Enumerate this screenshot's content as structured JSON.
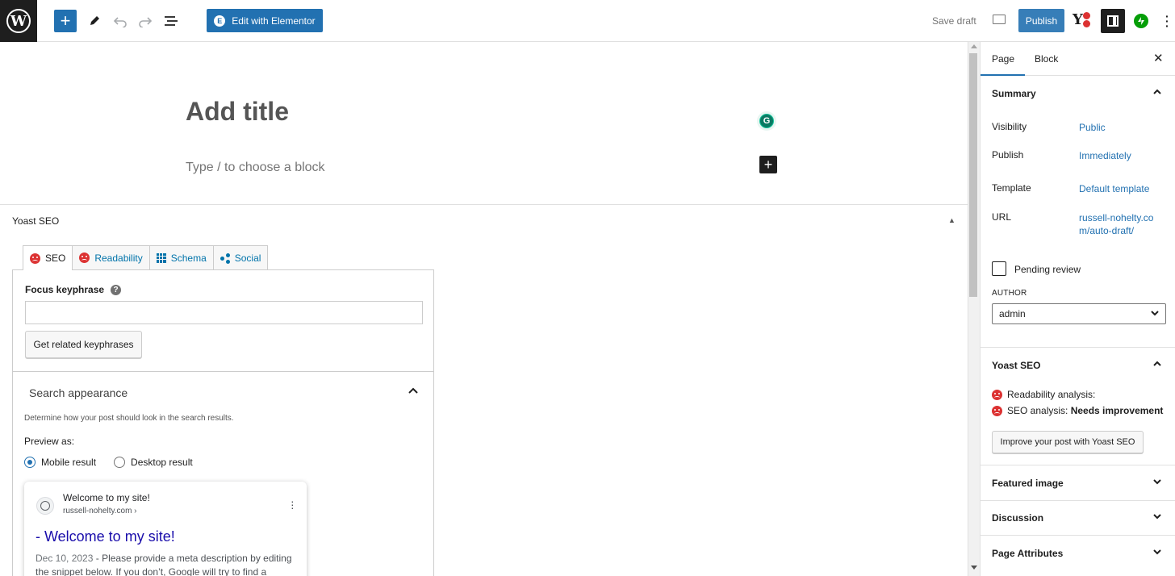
{
  "toolbar": {
    "wp_logo_text": "W",
    "add_icon_glyph": "+",
    "edit_elementor_label": "Edit with Elementor",
    "elementor_logo_text": "E",
    "save_draft_label": "Save draft",
    "publish_label": "Publish",
    "yoast_logo_text": "Y",
    "icons": [
      "wordpress-logo",
      "plus-icon",
      "pencil-icon",
      "undo-icon",
      "redo-icon",
      "list-view-icon",
      "preview-icon",
      "yoast-icon",
      "settings-icon",
      "jetpack-icon",
      "options-icon"
    ],
    "accent_color": "#2271b1"
  },
  "editor": {
    "title_placeholder": "Add title",
    "block_placeholder": "Type / to choose a block",
    "block_add_glyph": "+"
  },
  "yoast_metabox": {
    "heading": "Yoast SEO",
    "tabs": [
      {
        "label": "SEO",
        "icon": "sad-face-icon"
      },
      {
        "label": "Readability",
        "icon": "sad-face-icon"
      },
      {
        "label": "Schema",
        "icon": "grid-icon"
      },
      {
        "label": "Social",
        "icon": "share-icon"
      }
    ],
    "focus_keyphrase_label": "Focus keyphrase",
    "focus_keyphrase_value": "",
    "related_button": "Get related keyphrases",
    "search_appearance_title": "Search appearance",
    "search_appearance_desc": "Determine how your post should look in the search results.",
    "preview_as_label": "Preview as:",
    "mobile_result_label": "Mobile result",
    "desktop_result_label": "Desktop result",
    "selected_preview": "Mobile result",
    "serp": {
      "site_name": "Welcome to my site!",
      "url": "russell-nohelty.com ›",
      "title": "- Welcome to my site!",
      "date": "Dec 10, 2023",
      "separator": " - ",
      "description": "Please provide a meta description by editing the snippet below. If you don’t, Google will try to find a relevant part of your post to show in the search results."
    },
    "status_color": "#dc3232"
  },
  "sidebar": {
    "tabs": [
      "Page",
      "Block"
    ],
    "active_tab": "Page",
    "summary_title": "Summary",
    "rows": {
      "visibility_label": "Visibility",
      "visibility_value": "Public",
      "publish_label": "Publish",
      "publish_value": "Immediately",
      "template_label": "Template",
      "template_value": "Default template",
      "url_label": "URL",
      "url_value": "russell-nohelty.com/auto-draft/"
    },
    "pending_review_label": "Pending review",
    "pending_review_checked": false,
    "author_label": "AUTHOR",
    "author_value": "admin",
    "yoast_title": "Yoast SEO",
    "readability_text": "Readability analysis:",
    "seo_text_prefix": "SEO analysis: ",
    "seo_text_status": "Needs improvement",
    "improve_button": "Improve your post with Yoast SEO",
    "featured_image_title": "Featured image",
    "discussion_title": "Discussion",
    "page_attributes_title": "Page Attributes"
  }
}
